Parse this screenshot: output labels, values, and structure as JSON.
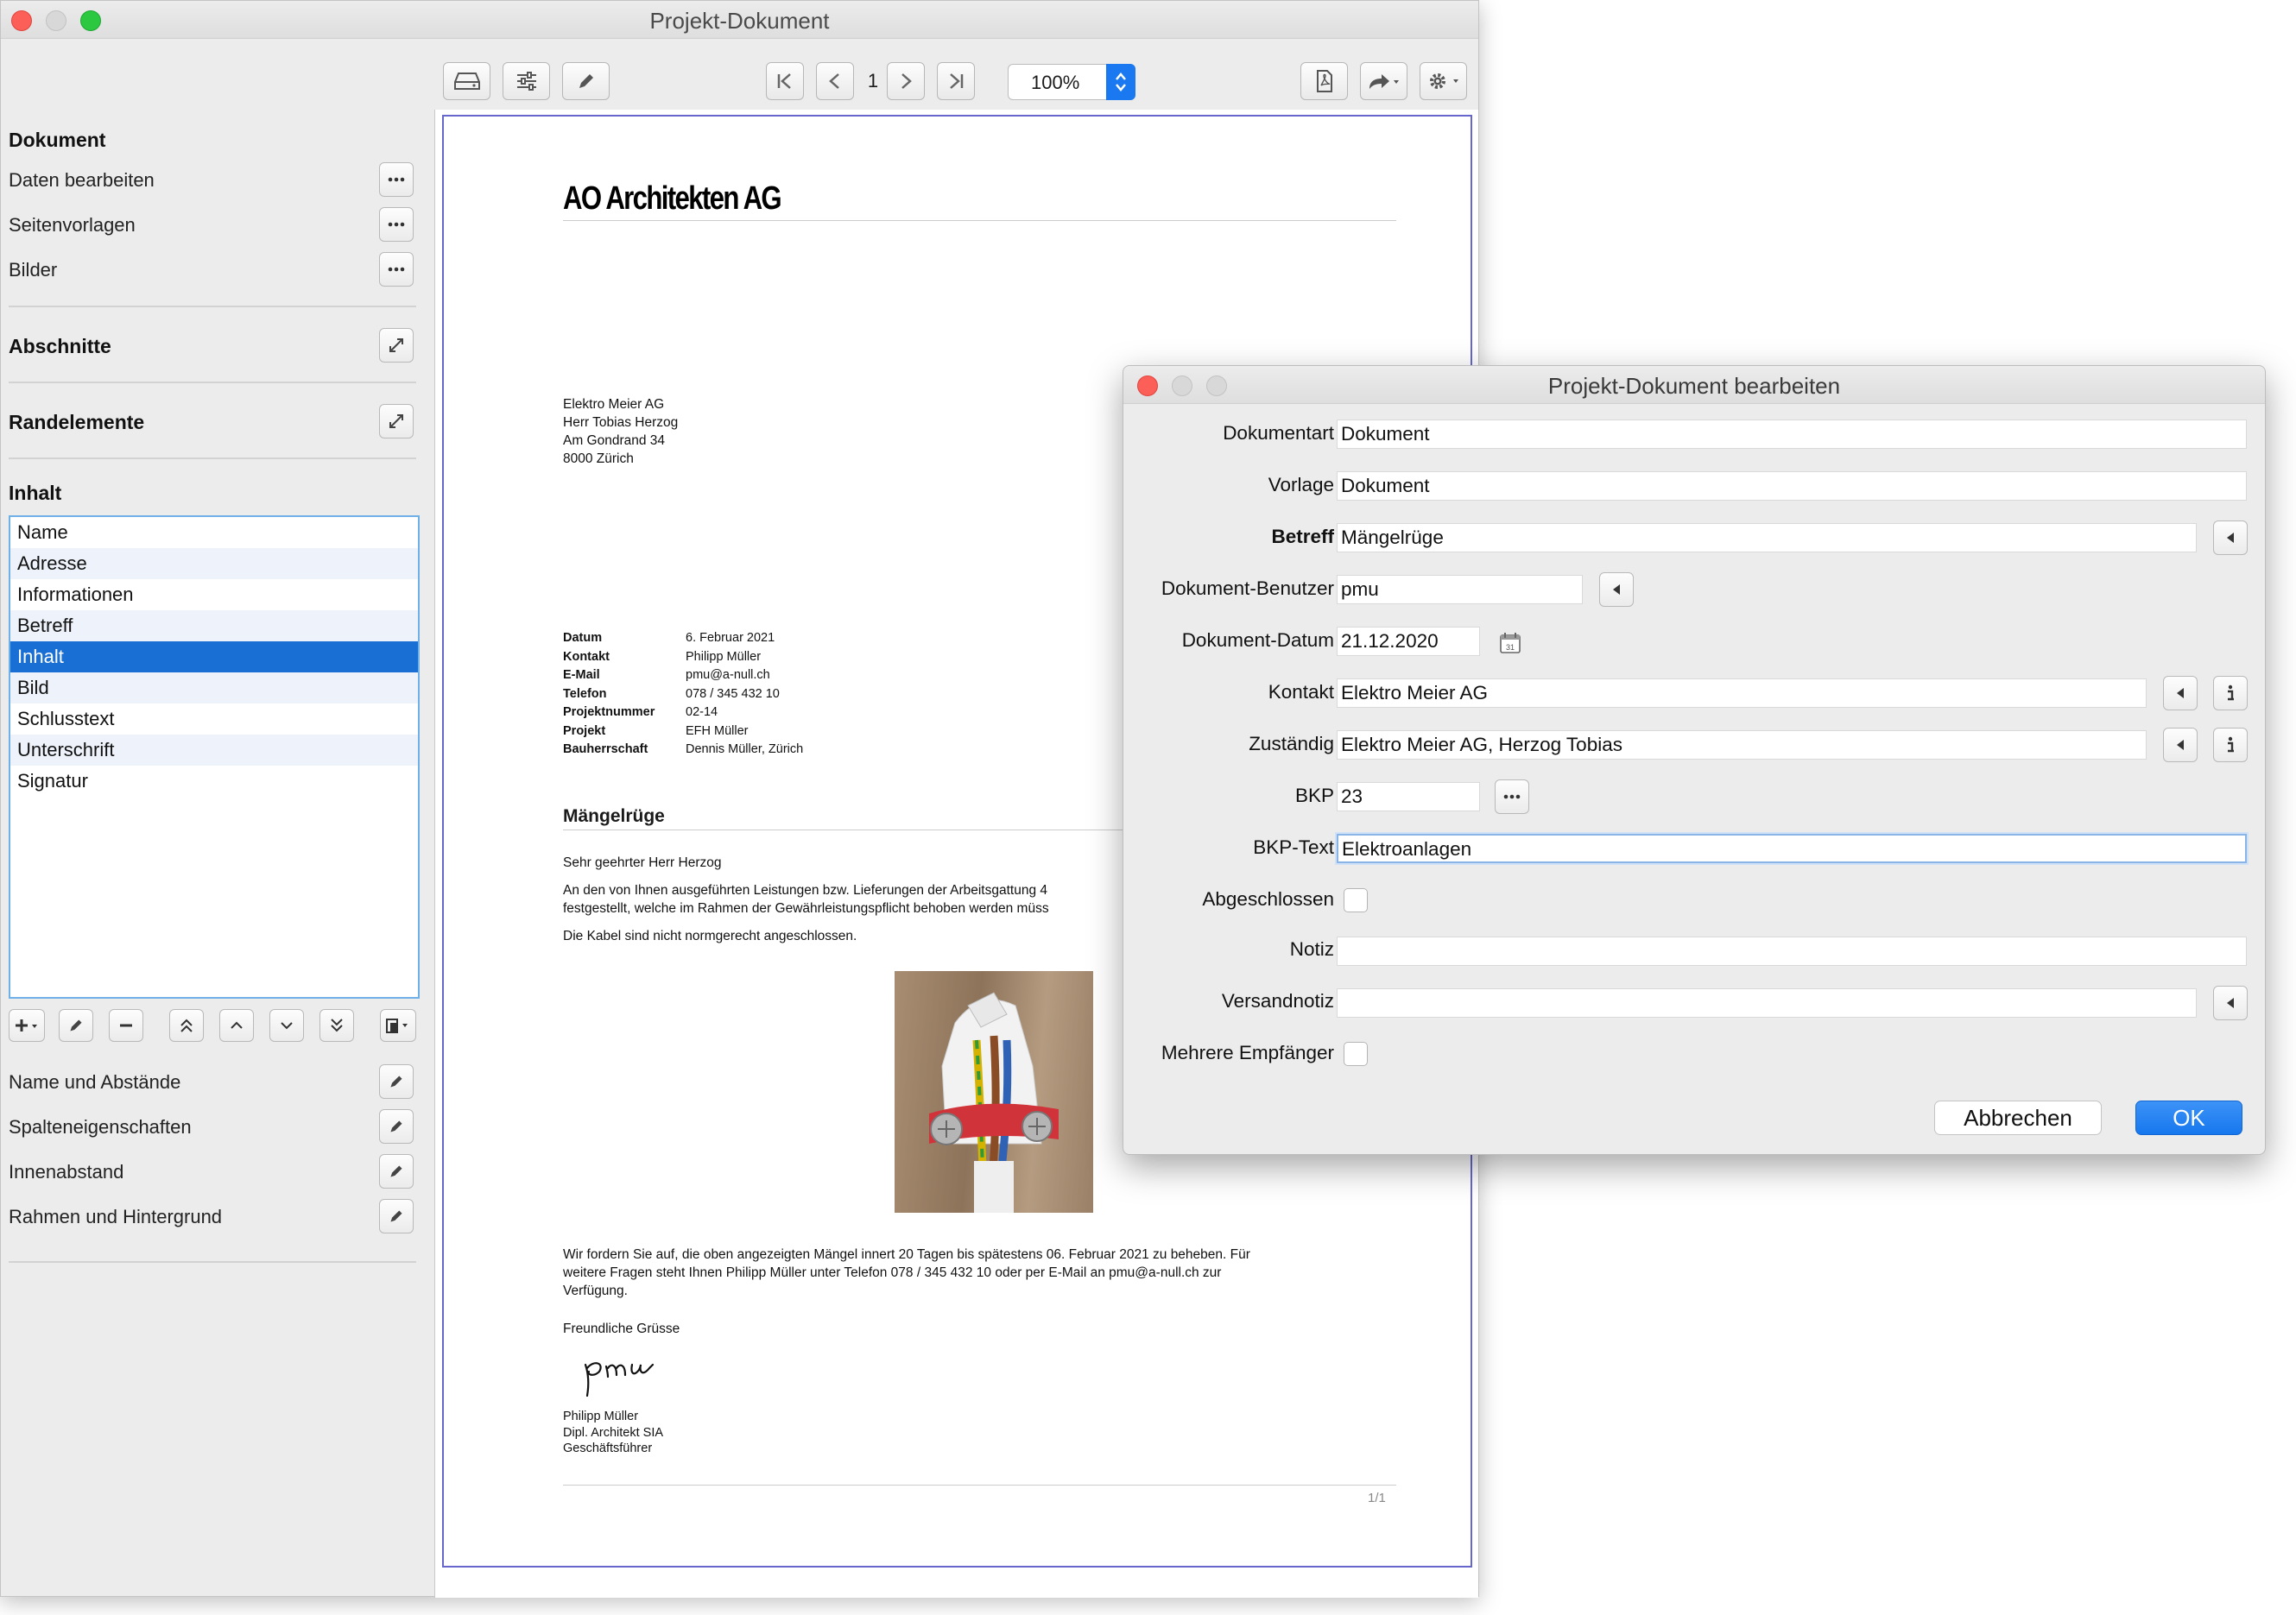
{
  "main_window": {
    "title": "Projekt-Dokument",
    "toolbar": {
      "page_number": "1",
      "zoom": "100%"
    }
  },
  "sidebar": {
    "dokument_heading": "Dokument",
    "dokument_items": [
      "Daten bearbeiten",
      "Seitenvorlagen",
      "Bilder"
    ],
    "abschnitte_heading": "Abschnitte",
    "randelemente_heading": "Randelemente",
    "inhalt_heading": "Inhalt",
    "content_items": [
      "Name",
      "Adresse",
      "Informationen",
      "Betreff",
      "Inhalt",
      "Bild",
      "Schlusstext",
      "Unterschrift",
      "Signatur"
    ],
    "selected_item": "Inhalt",
    "property_items": [
      "Name und Abstände",
      "Spalteneigenschaften",
      "Innenabstand",
      "Rahmen und Hintergrund"
    ]
  },
  "document": {
    "company": "AO Architekten AG",
    "address": [
      "Elektro Meier AG",
      "Herr Tobias Herzog",
      "Am Gondrand 34",
      "8000 Zürich"
    ],
    "info_labels": [
      "Datum",
      "Kontakt",
      "E-Mail",
      "Telefon",
      "Projektnummer",
      "Projekt",
      "Bauherrschaft"
    ],
    "info_values": [
      "6. Februar 2021",
      "Philipp Müller",
      "pmu@a-null.ch",
      "078 / 345 432 10",
      "02-14",
      "EFH Müller",
      "Dennis Müller, Zürich"
    ],
    "subject": "Mängelrüge",
    "salutation": "Sehr geehrter Herr Herzog",
    "body_line1": "An den von Ihnen ausgeführten Leistungen bzw. Lieferungen der Arbeitsgattung 4",
    "body_line2": "festgestellt, welche im Rahmen der Gewährleistungspflicht behoben werden müss",
    "body_line3": "Die Kabel sind nicht normgerecht angeschlossen.",
    "closing_line1": "Wir fordern Sie auf, die oben angezeigten Mängel innert 20 Tagen bis spätestens 06. Februar 2021 zu beheben. Für",
    "closing_line2": "weitere Fragen steht Ihnen Philipp Müller unter Telefon 078 / 345 432 10 oder per E-Mail an pmu@a-null.ch zur",
    "closing_line3": "Verfügung.",
    "greeting": "Freundliche Grüsse",
    "signature_script": "pmu",
    "signer": [
      "Philipp Müller",
      "Dipl. Architekt SIA",
      "Geschäftsführer"
    ],
    "page_indicator": "1/1"
  },
  "dialog": {
    "title": "Projekt-Dokument bearbeiten",
    "labels": {
      "dokumentart": "Dokumentart",
      "vorlage": "Vorlage",
      "betreff": "Betreff",
      "benutzer": "Dokument-Benutzer",
      "datum": "Dokument-Datum",
      "kontakt": "Kontakt",
      "zustaendig": "Zuständig",
      "bkp": "BKP",
      "bkp_text": "BKP-Text",
      "abgeschlossen": "Abgeschlossen",
      "notiz": "Notiz",
      "versandnotiz": "Versandnotiz",
      "mehrere": "Mehrere Empfänger"
    },
    "values": {
      "dokumentart": "Dokument",
      "vorlage": "Dokument",
      "betreff": "Mängelrüge",
      "benutzer": "pmu",
      "datum": "21.12.2020",
      "kontakt": "Elektro Meier AG",
      "zustaendig": "Elektro Meier AG, Herzog Tobias",
      "bkp": "23",
      "bkp_text": "Elektroanlagen",
      "notiz": "",
      "versandnotiz": ""
    },
    "abgeschlossen_checked": false,
    "mehrere_checked": false,
    "cancel_label": "Abbrechen",
    "ok_label": "OK"
  },
  "colors": {
    "accent": "#1a6fd4",
    "ok_button": "#1677ee",
    "page_frame": "#6666cc",
    "list_border": "#6fb0e8"
  }
}
